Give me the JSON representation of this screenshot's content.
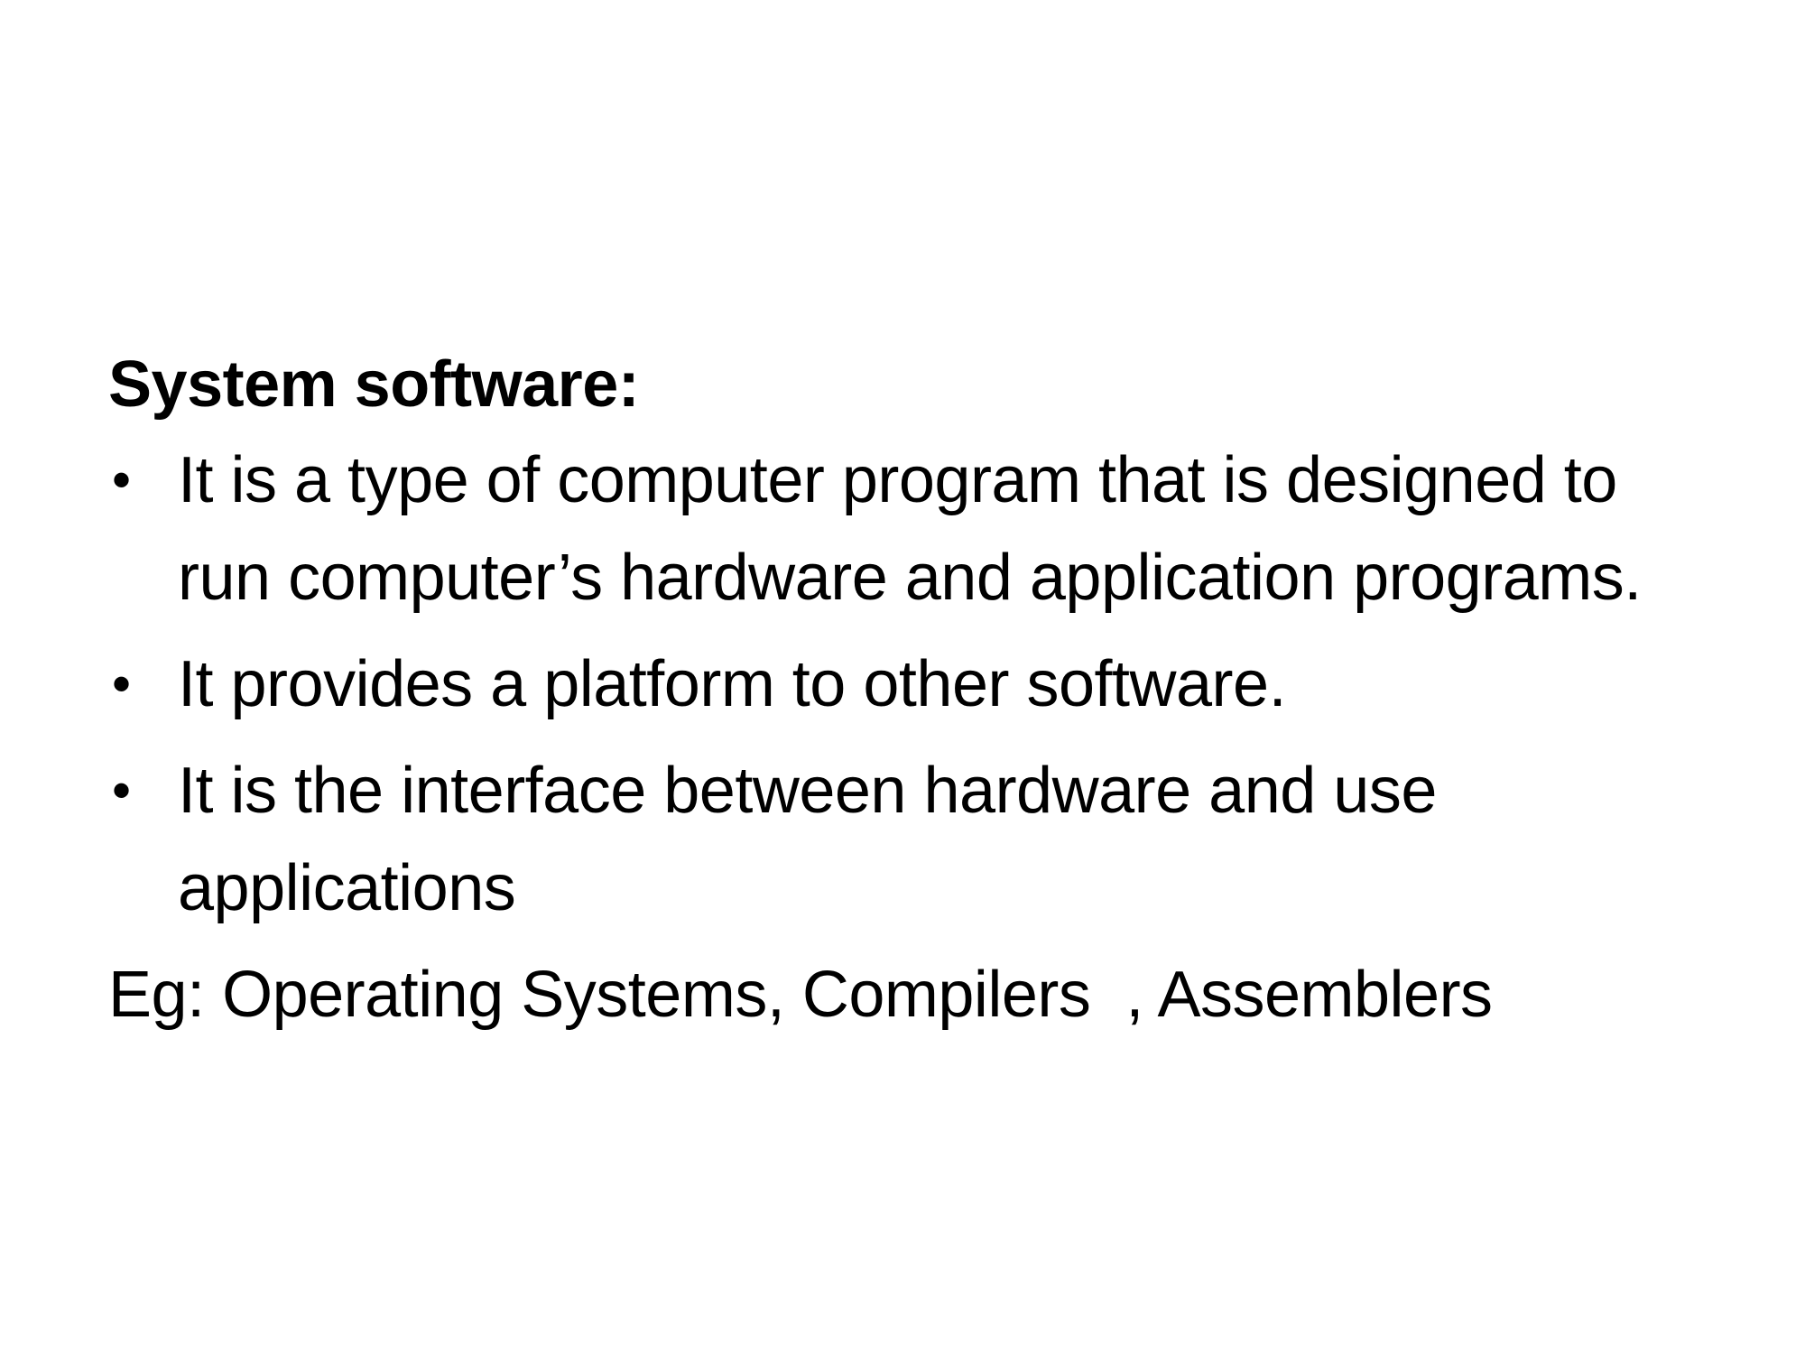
{
  "slide": {
    "heading": "System software:",
    "bullets": [
      {
        "symbol": "•",
        "text": "It is a type of computer program that is designed to run computer’s hardware and application programs."
      },
      {
        "symbol": "•",
        "text": "It provides a platform to other software."
      },
      {
        "symbol": "•",
        "text": "It is the interface between hardware and use applications"
      }
    ],
    "example": "Eg: Operating Systems, Compilers  , Assemblers"
  }
}
